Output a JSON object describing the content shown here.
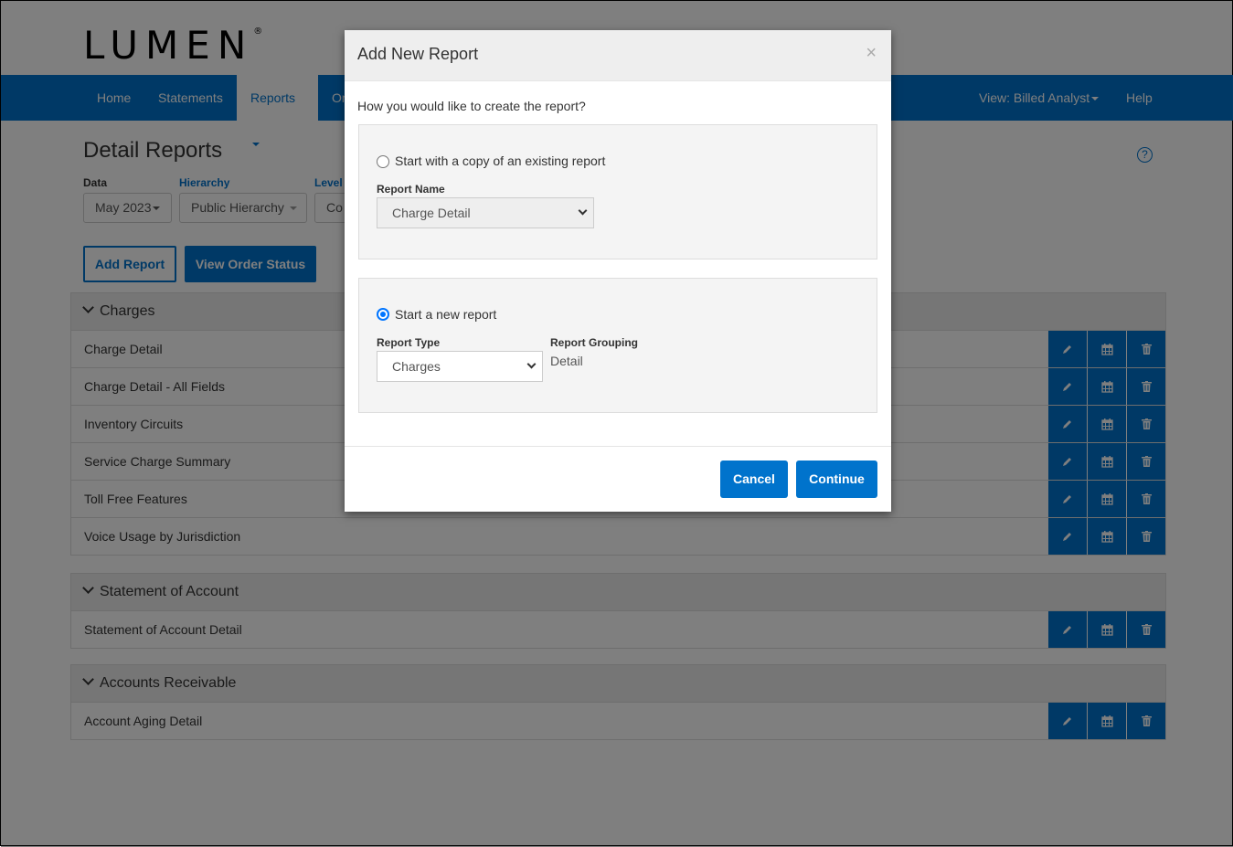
{
  "brand": {
    "logo": "LUMEN",
    "reg": "®"
  },
  "nav": {
    "items": [
      "Home",
      "Statements",
      "Reports",
      "Or"
    ],
    "view": "View: Billed Analyst",
    "help": "Help"
  },
  "page": {
    "title": "Detail Reports",
    "filters": [
      {
        "label": "Data",
        "value": "May 2023"
      },
      {
        "label": "Hierarchy",
        "value": "Public Hierarchy"
      },
      {
        "label": "Level",
        "value": "Co"
      }
    ],
    "add_report": "Add Report",
    "view_order_status": "View Order Status"
  },
  "sections": [
    {
      "title": "Charges",
      "rows": [
        "Charge Detail",
        "Charge Detail - All Fields",
        "Inventory Circuits",
        "Service Charge Summary",
        "Toll Free Features",
        "Voice Usage by Jurisdiction"
      ]
    },
    {
      "title": "Statement of Account",
      "rows": [
        "Statement of Account Detail"
      ]
    },
    {
      "title": "Accounts Receivable",
      "rows": [
        "Account Aging Detail"
      ]
    }
  ],
  "icons": {
    "edit": "pencil-icon",
    "schedule": "calendar-icon",
    "delete": "trash-icon",
    "help": "question-circle-icon"
  },
  "modal": {
    "title": "Add New Report",
    "close": "×",
    "question": "How you would like to create the report?",
    "copy_option": "Start with a copy of an existing report",
    "report_name_label": "Report Name",
    "report_name_value": "Charge Detail",
    "new_option": "Start a new report",
    "new_selected": true,
    "report_type_label": "Report Type",
    "report_type_value": "Charges",
    "grouping_label": "Report Grouping",
    "grouping_value": "Detail",
    "cancel": "Cancel",
    "continue": "Continue"
  },
  "colors": {
    "brand_blue": "#0073cc"
  }
}
